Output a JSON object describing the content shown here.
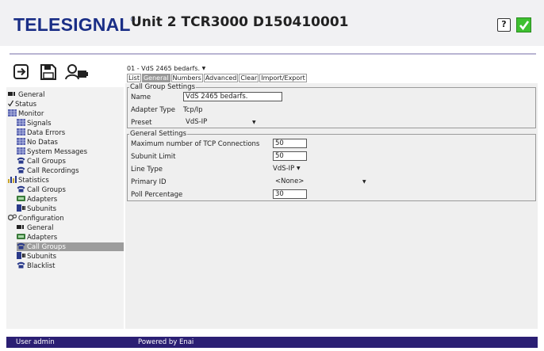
{
  "header": {
    "logo": "TELESIGNAL",
    "logo_mark": "®",
    "title": "Unit 2 TCR3000 D150410001",
    "help_label": "?",
    "status_color": "#3ec030"
  },
  "toolbar": {
    "icons": [
      "logout-icon",
      "save-icon",
      "user-key-icon"
    ]
  },
  "sidebar": {
    "items": [
      {
        "label": "General",
        "icon": "unit-icon"
      },
      {
        "label": "Status",
        "icon": "check-icon"
      },
      {
        "label": "Monitor",
        "icon": "monitor-icon"
      },
      {
        "label": "Signals",
        "icon": "monitor-icon"
      },
      {
        "label": "Data Errors",
        "icon": "monitor-icon"
      },
      {
        "label": "No Datas",
        "icon": "monitor-icon"
      },
      {
        "label": "System Messages",
        "icon": "monitor-icon"
      },
      {
        "label": "Call Groups",
        "icon": "phone-icon"
      },
      {
        "label": "Call Recordings",
        "icon": "phone-icon"
      },
      {
        "label": "Statistics",
        "icon": "chart-icon"
      },
      {
        "label": "Call Groups",
        "icon": "phone-icon"
      },
      {
        "label": "Adapters",
        "icon": "adapter-icon"
      },
      {
        "label": "Subunits",
        "icon": "subunit-icon"
      },
      {
        "label": "Configuration",
        "icon": "gears-icon"
      },
      {
        "label": "General",
        "icon": "unit-icon"
      },
      {
        "label": "Adapters",
        "icon": "adapter-icon"
      },
      {
        "label": "Call Groups",
        "icon": "phone-icon"
      },
      {
        "label": "Subunits",
        "icon": "subunit-icon"
      },
      {
        "label": "Blacklist",
        "icon": "phone-icon"
      }
    ],
    "selected_index": 16
  },
  "main": {
    "group_select": "01 - VdS 2465 bedarfs.",
    "tabs": [
      "List",
      "General",
      "Numbers",
      "Advanced",
      "Clear",
      "Import/Export"
    ],
    "active_tab": "General",
    "call_group_settings": {
      "legend": "Call Group Settings",
      "name_label": "Name",
      "name_value": "VdS 2465 bedarfs.",
      "adapter_type_label": "Adapter Type",
      "adapter_type_value": "Tcp/Ip",
      "preset_label": "Preset",
      "preset_value": "VdS-IP"
    },
    "general_settings": {
      "legend": "General Settings",
      "max_tcp_label": "Maximum number of TCP Connections",
      "max_tcp_value": "50",
      "subunit_limit_label": "Subunit Limit",
      "subunit_limit_value": "50",
      "line_type_label": "Line Type",
      "line_type_value": "VdS-IP",
      "primary_id_label": "Primary ID",
      "primary_id_value": "<None>",
      "poll_label": "Poll Percentage",
      "poll_value": "30"
    }
  },
  "footer": {
    "user": "User admin",
    "powered": "Powered by Enai"
  }
}
